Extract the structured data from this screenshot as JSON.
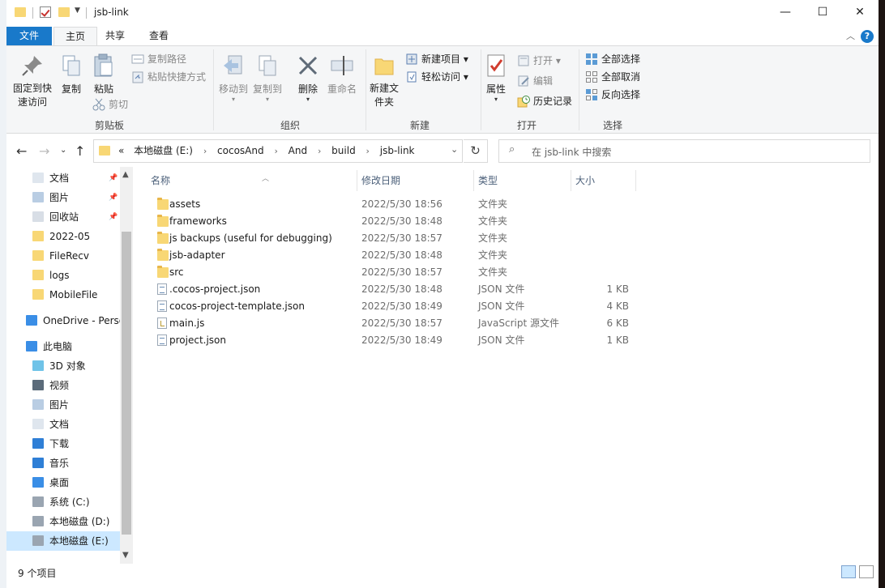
{
  "titlebar": {
    "title": "jsb-link",
    "minimize": "—",
    "maximize": "☐",
    "close": "✕"
  },
  "tabs": {
    "file": "文件",
    "home": "主页",
    "share": "共享",
    "view": "查看"
  },
  "ribbon": {
    "clipboard": {
      "label": "剪贴板",
      "pin": "固定到快速访问",
      "copy": "复制",
      "paste": "粘贴",
      "copy_path": "复制路径",
      "paste_shortcut": "粘贴快捷方式",
      "cut": "剪切"
    },
    "organize": {
      "label": "组织",
      "move_to": "移动到",
      "copy_to": "复制到",
      "delete": "删除",
      "rename": "重命名"
    },
    "new": {
      "label": "新建",
      "new_folder": "新建文件夹",
      "new_item": "新建项目 ▾",
      "easy_access": "轻松访问 ▾"
    },
    "open": {
      "label": "打开",
      "properties": "属性",
      "open": "打开 ▾",
      "edit": "编辑",
      "history": "历史记录"
    },
    "select": {
      "label": "选择",
      "select_all": "全部选择",
      "select_none": "全部取消",
      "invert": "反向选择"
    }
  },
  "address": {
    "crumbs": [
      "«",
      "本地磁盘 (E:)",
      "cocosAnd",
      "And",
      "build",
      "jsb-link"
    ],
    "search_placeholder": "在 jsb-link 中搜索"
  },
  "navpane": {
    "quick": [
      {
        "label": "文档",
        "icon": "documents-icon",
        "pinned": true
      },
      {
        "label": "图片",
        "icon": "pictures-icon",
        "pinned": true
      },
      {
        "label": "回收站",
        "icon": "recycle-bin-icon",
        "pinned": true
      },
      {
        "label": "2022-05",
        "icon": "folder-icon",
        "pinned": false
      },
      {
        "label": "FileRecv",
        "icon": "folder-icon",
        "pinned": false
      },
      {
        "label": "logs",
        "icon": "folder-icon",
        "pinned": false
      },
      {
        "label": "MobileFile",
        "icon": "folder-icon",
        "pinned": false
      }
    ],
    "onedrive": "OneDrive - Perso",
    "thispc": "此电脑",
    "pc_items": [
      {
        "label": "3D 对象",
        "icon": "3d-objects-icon"
      },
      {
        "label": "视频",
        "icon": "videos-icon"
      },
      {
        "label": "图片",
        "icon": "pictures-icon"
      },
      {
        "label": "文档",
        "icon": "documents-icon"
      },
      {
        "label": "下载",
        "icon": "downloads-icon"
      },
      {
        "label": "音乐",
        "icon": "music-icon"
      },
      {
        "label": "桌面",
        "icon": "desktop-icon"
      },
      {
        "label": "系统 (C:)",
        "icon": "drive-icon"
      },
      {
        "label": "本地磁盘 (D:)",
        "icon": "drive-icon"
      },
      {
        "label": "本地磁盘 (E:)",
        "icon": "drive-icon",
        "selected": true
      }
    ]
  },
  "columns": {
    "name": "名称",
    "date": "修改日期",
    "type": "类型",
    "size": "大小"
  },
  "files": [
    {
      "name": "assets",
      "date": "2022/5/30 18:56",
      "type": "文件夹",
      "size": "",
      "kind": "folder"
    },
    {
      "name": "frameworks",
      "date": "2022/5/30 18:48",
      "type": "文件夹",
      "size": "",
      "kind": "folder"
    },
    {
      "name": "js backups (useful for debugging)",
      "date": "2022/5/30 18:57",
      "type": "文件夹",
      "size": "",
      "kind": "folder"
    },
    {
      "name": "jsb-adapter",
      "date": "2022/5/30 18:48",
      "type": "文件夹",
      "size": "",
      "kind": "folder"
    },
    {
      "name": "src",
      "date": "2022/5/30 18:57",
      "type": "文件夹",
      "size": "",
      "kind": "folder"
    },
    {
      "name": ".cocos-project.json",
      "date": "2022/5/30 18:48",
      "type": "JSON 文件",
      "size": "1 KB",
      "kind": "json"
    },
    {
      "name": "cocos-project-template.json",
      "date": "2022/5/30 18:49",
      "type": "JSON 文件",
      "size": "4 KB",
      "kind": "json"
    },
    {
      "name": "main.js",
      "date": "2022/5/30 18:57",
      "type": "JavaScript 源文件",
      "size": "6 KB",
      "kind": "js"
    },
    {
      "name": "project.json",
      "date": "2022/5/30 18:49",
      "type": "JSON 文件",
      "size": "1 KB",
      "kind": "json"
    }
  ],
  "status": {
    "count": "9 个项目"
  }
}
